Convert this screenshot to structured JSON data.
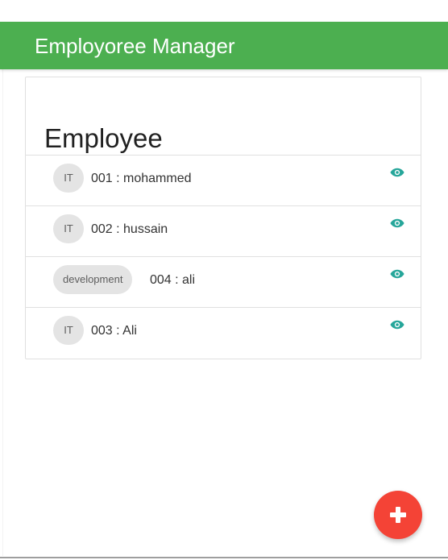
{
  "navbar": {
    "brand": "Employoree Manager",
    "color": "#4caf50"
  },
  "card": {
    "title": "Employee",
    "items": [
      {
        "department": "IT",
        "label": "001 : mohammed",
        "action_icon": "eye-icon"
      },
      {
        "department": "IT",
        "label": "002 : hussain",
        "action_icon": "eye-icon"
      },
      {
        "department": "development",
        "label": "004 : ali",
        "action_icon": "eye-icon"
      },
      {
        "department": "IT",
        "label": "003 : Ali",
        "action_icon": "eye-icon"
      }
    ]
  },
  "fab": {
    "icon": "plus-icon",
    "color": "#f44336"
  },
  "accent": "#26a69a"
}
